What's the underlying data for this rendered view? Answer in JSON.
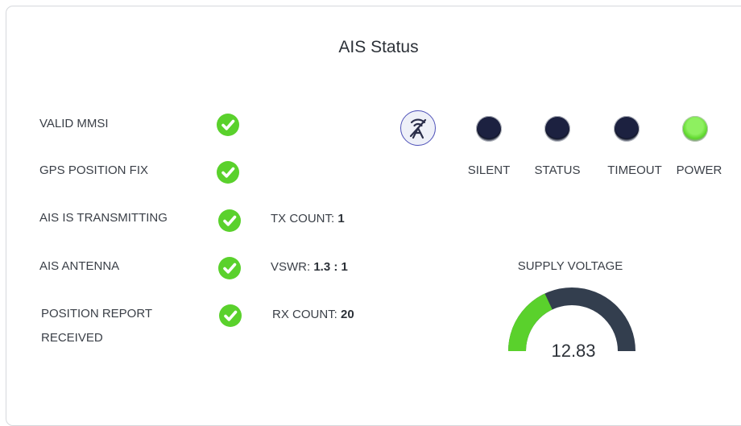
{
  "panel": {
    "title": "AIS Status"
  },
  "status_items": [
    {
      "label": "VALID MMSI",
      "ok": true
    },
    {
      "label": "GPS POSITION FIX",
      "ok": true
    },
    {
      "label": "AIS IS TRANSMITTING",
      "ok": true
    },
    {
      "label": "AIS ANTENNA",
      "ok": true
    },
    {
      "label_line1": "POSITION REPORT",
      "label_line2": "RECEIVED",
      "ok": true
    }
  ],
  "stats": {
    "tx_label": "TX COUNT: ",
    "tx_value": "1",
    "vswr_label": "VSWR: ",
    "vswr_value": "1.3 : 1",
    "rx_label": "RX COUNT: ",
    "rx_value": "20"
  },
  "indicators": {
    "antenna_icon": "antenna-off-icon",
    "leds": [
      {
        "label": "SILENT",
        "state": "off"
      },
      {
        "label": "STATUS",
        "state": "off"
      },
      {
        "label": "TIMEOUT",
        "state": "off"
      },
      {
        "label": "POWER",
        "state": "on"
      }
    ]
  },
  "supply_voltage": {
    "title": "SUPPLY VOLTAGE",
    "value": "12.83",
    "fill_fraction": 0.36,
    "fill_color": "#5ad12c",
    "track_color": "#333e4e"
  }
}
